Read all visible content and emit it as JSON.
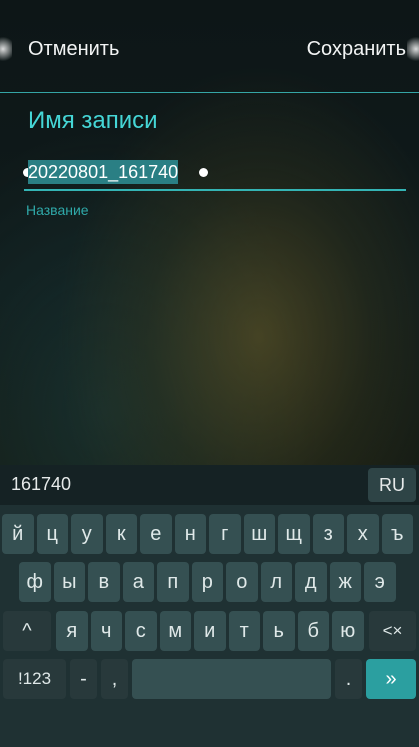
{
  "top_bar": {
    "cancel_label": "Отменить",
    "save_label": "Сохранить"
  },
  "form": {
    "title": "Имя записи",
    "field_value": "20220801_161740",
    "field_hint": "Название"
  },
  "keyboard": {
    "suggestion": "161740",
    "language_label": "RU",
    "row1": [
      "й",
      "ц",
      "у",
      "к",
      "е",
      "н",
      "г",
      "ш",
      "щ",
      "з",
      "х",
      "ъ"
    ],
    "row2": [
      "ф",
      "ы",
      "в",
      "а",
      "п",
      "р",
      "о",
      "л",
      "д",
      "ж",
      "э"
    ],
    "row3": [
      "я",
      "ч",
      "с",
      "м",
      "и",
      "т",
      "ь",
      "б",
      "ю"
    ],
    "shift_label": "^",
    "backspace_label": "<×",
    "symbols_label": "!123",
    "minus_label": "-",
    "comma_label": ",",
    "period_label": ".",
    "enter_label": "»"
  },
  "colors": {
    "accent": "#45d6d6",
    "key": "#355052",
    "enter": "#2b9fa0"
  }
}
